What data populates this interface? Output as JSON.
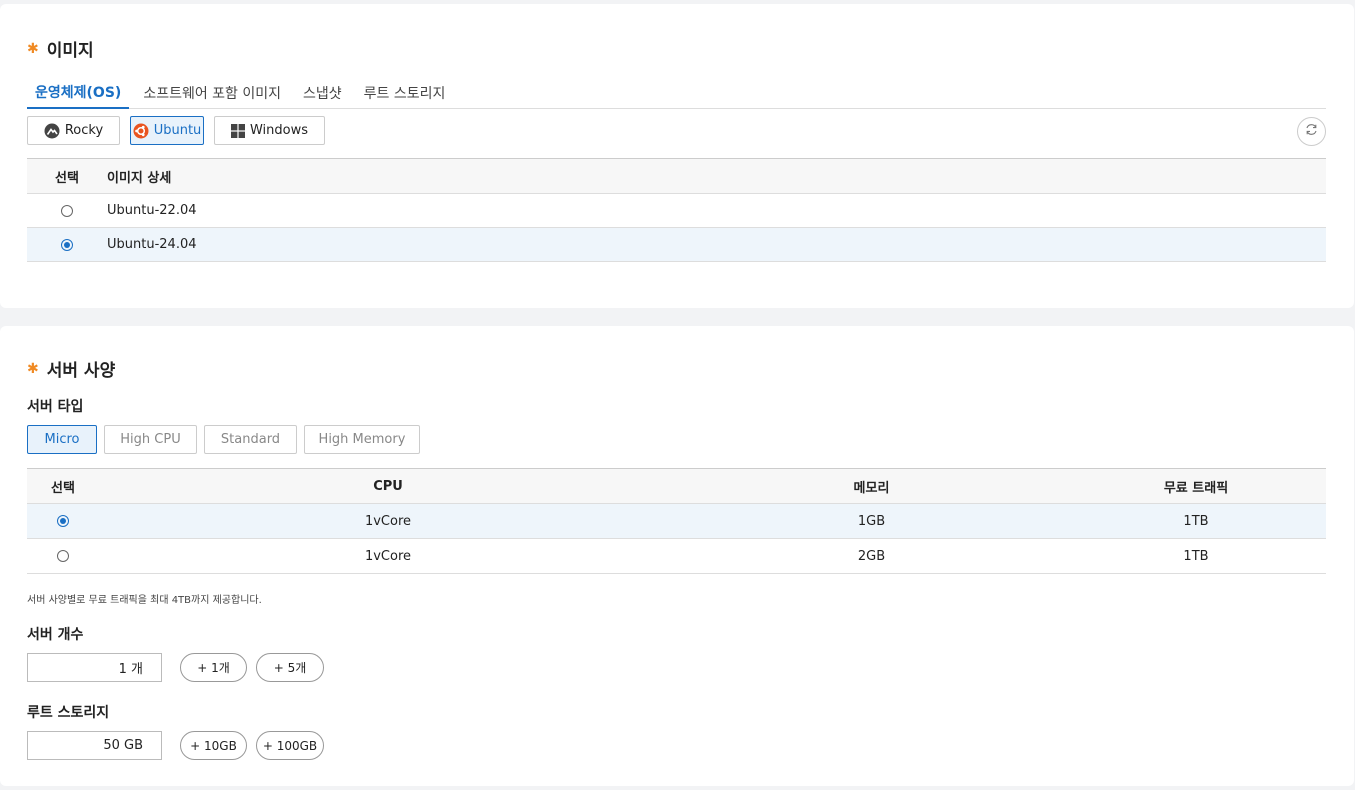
{
  "image_section": {
    "title": "이미지",
    "tabs": [
      "운영체제(OS)",
      "소프트웨어 포함 이미지",
      "스냅샷",
      "루트 스토리지"
    ],
    "os_buttons": [
      "Rocky",
      "Ubuntu",
      "Windows"
    ],
    "table": {
      "headers": [
        "선택",
        "이미지 상세"
      ],
      "rows": [
        "Ubuntu-22.04",
        "Ubuntu-24.04"
      ]
    }
  },
  "spec_section": {
    "title": "서버 사양",
    "server_type_label": "서버 타입",
    "types": [
      "Micro",
      "High CPU",
      "Standard",
      "High Memory"
    ],
    "table": {
      "headers": [
        "선택",
        "CPU",
        "메모리",
        "무료 트래픽"
      ],
      "rows": [
        {
          "cpu": "1vCore",
          "memory": "1GB",
          "traffic": "1TB"
        },
        {
          "cpu": "1vCore",
          "memory": "2GB",
          "traffic": "1TB"
        }
      ]
    },
    "note": "서버 사양별로 무료 트래픽을 최대 4TB까지 제공합니다.",
    "count_label": "서버 개수",
    "count_value": "1 개",
    "count_buttons": [
      "+ 1개",
      "+ 5개"
    ],
    "storage_label": "루트 스토리지",
    "storage_value": "50 GB",
    "storage_buttons": [
      "+ 10GB",
      "+ 100GB"
    ]
  },
  "colors": {
    "accent": "#1a6fc4",
    "star": "#f08a24"
  }
}
